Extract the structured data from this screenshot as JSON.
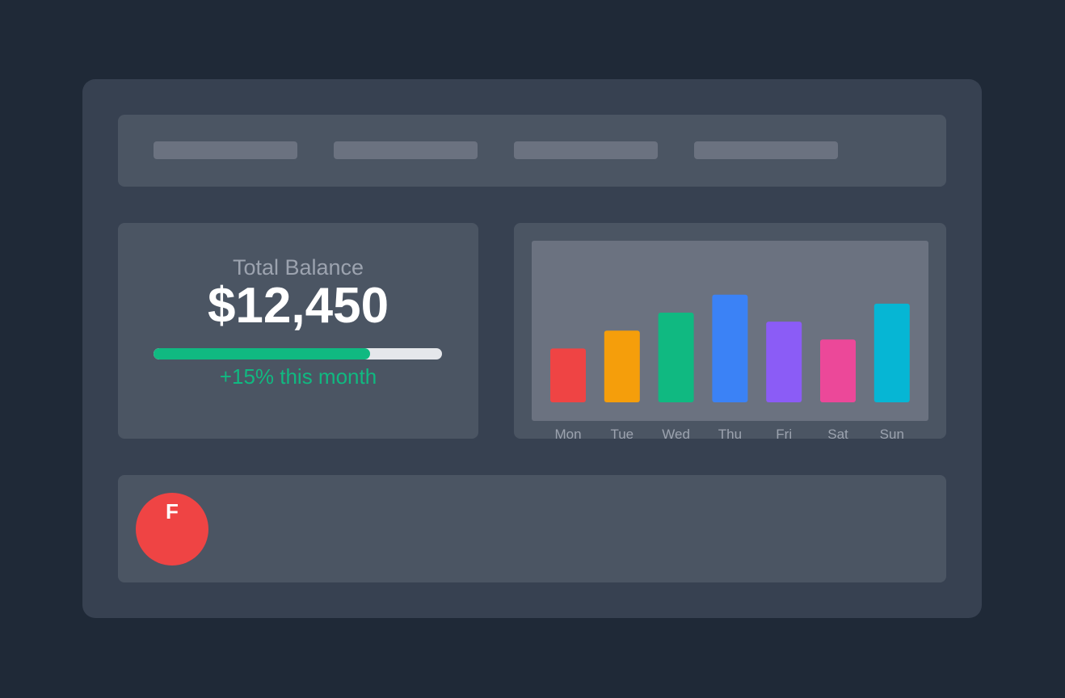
{
  "balance": {
    "label": "Total Balance",
    "value": "$12,450",
    "progress": 0.75,
    "change": "+15% this month",
    "progress_color": "#10b981",
    "track_color": "#e5e7eb"
  },
  "avatar": {
    "initial": "F",
    "color": "#ef4444"
  },
  "chart_data": {
    "type": "bar",
    "categories": [
      "Mon",
      "Tue",
      "Wed",
      "Thu",
      "Fri",
      "Sat",
      "Sun"
    ],
    "values": [
      30,
      40,
      50,
      60,
      45,
      35,
      55
    ],
    "colors": [
      "#ef4444",
      "#f59e0b",
      "#10b981",
      "#3b82f6",
      "#8b5cf6",
      "#ec4899",
      "#06b6d4"
    ],
    "title": "",
    "xlabel": "",
    "ylabel": "",
    "ylim": [
      0,
      90
    ],
    "grid": false
  }
}
